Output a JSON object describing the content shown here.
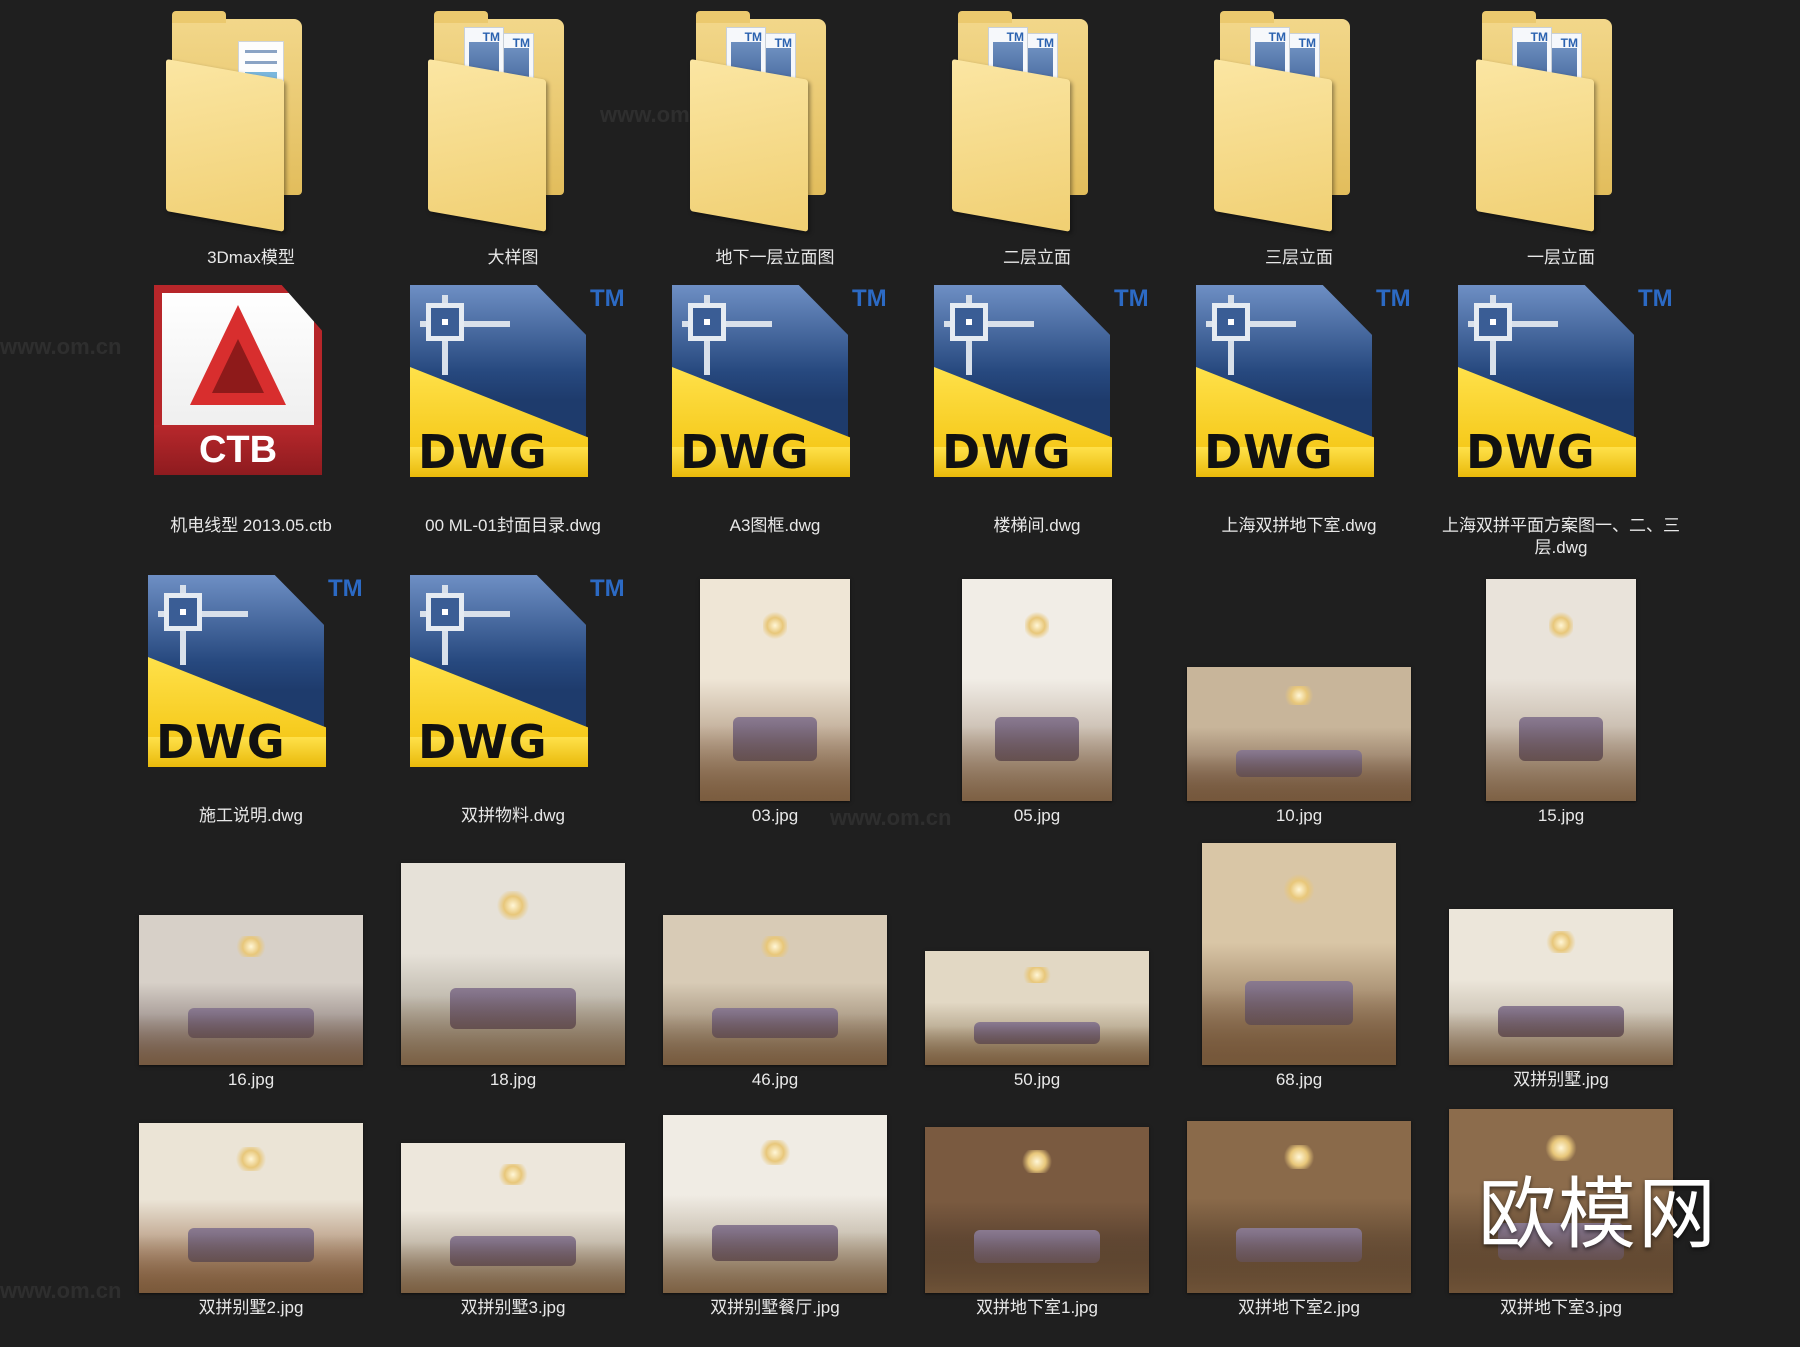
{
  "watermark": {
    "site": "www.om.cn",
    "brand_logo": "欧模网"
  },
  "icons": {
    "folder": "folder-icon",
    "dwg": "dwg-file-icon",
    "ctb": "ctb-file-icon",
    "image": "image-thumbnail"
  },
  "colors": {
    "background": "#1f1f1f",
    "label": "#e8e8e8",
    "dwg_yellow": "#f2c10a",
    "dwg_blue": "#27497f",
    "ctb_red": "#b7262a",
    "folder_yellow": "#f0cf72"
  },
  "files": [
    {
      "name": "3Dmax模型",
      "type": "folder"
    },
    {
      "name": "大样图",
      "type": "folder-dwg"
    },
    {
      "name": "地下一层立面图",
      "type": "folder-dwg"
    },
    {
      "name": "二层立面",
      "type": "folder-dwg"
    },
    {
      "name": "三层立面",
      "type": "folder-dwg"
    },
    {
      "name": "一层立面",
      "type": "folder-dwg"
    },
    {
      "name": "机电线型 2013.05.ctb",
      "type": "ctb",
      "badge": "CTB"
    },
    {
      "name": "00 ML-01封面目录.dwg",
      "type": "dwg",
      "badge": "DWG",
      "tm": "TM"
    },
    {
      "name": "A3图框.dwg",
      "type": "dwg",
      "badge": "DWG",
      "tm": "TM"
    },
    {
      "name": "楼梯间.dwg",
      "type": "dwg",
      "badge": "DWG",
      "tm": "TM"
    },
    {
      "name": "上海双拼地下室.dwg",
      "type": "dwg",
      "badge": "DWG",
      "tm": "TM"
    },
    {
      "name": "上海双拼平面方案图一、二、三层.dwg",
      "type": "dwg",
      "badge": "DWG",
      "tm": "TM"
    },
    {
      "name": "施工说明.dwg",
      "type": "dwg",
      "badge": "DWG",
      "tm": "TM"
    },
    {
      "name": "双拼物料.dwg",
      "type": "dwg",
      "badge": "DWG",
      "tm": "TM"
    },
    {
      "name": "03.jpg",
      "type": "jpg"
    },
    {
      "name": "05.jpg",
      "type": "jpg"
    },
    {
      "name": "10.jpg",
      "type": "jpg"
    },
    {
      "name": "15.jpg",
      "type": "jpg"
    },
    {
      "name": "16.jpg",
      "type": "jpg"
    },
    {
      "name": "18.jpg",
      "type": "jpg"
    },
    {
      "name": "46.jpg",
      "type": "jpg"
    },
    {
      "name": "50.jpg",
      "type": "jpg"
    },
    {
      "name": "68.jpg",
      "type": "jpg"
    },
    {
      "name": "双拼别墅.jpg",
      "type": "jpg"
    },
    {
      "name": "双拼别墅2.jpg",
      "type": "jpg"
    },
    {
      "name": "双拼别墅3.jpg",
      "type": "jpg"
    },
    {
      "name": "双拼别墅餐厅.jpg",
      "type": "jpg"
    },
    {
      "name": "双拼地下室1.jpg",
      "type": "jpg"
    },
    {
      "name": "双拼地下室2.jpg",
      "type": "jpg"
    },
    {
      "name": "双拼地下室3.jpg",
      "type": "jpg"
    }
  ]
}
